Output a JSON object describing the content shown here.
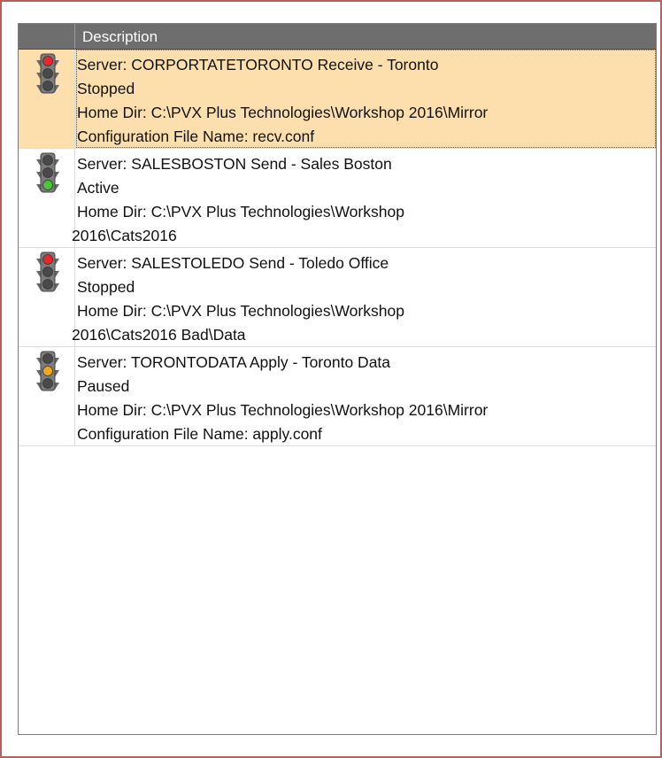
{
  "table": {
    "header": {
      "description": "Description"
    },
    "rows": [
      {
        "status_light": "red-traffic-light-icon",
        "server_line": "Server: CORPORTATETORONTO  Receive -  Toronto",
        "status": "Stopped",
        "detail1": "Home Dir: C:\\PVX Plus Technologies\\Workshop 2016\\Mirror",
        "detail2": "Configuration File Name: recv.conf",
        "selected": true
      },
      {
        "status_light": "green-traffic-light-icon",
        "server_line": "Server: SALESBOSTON  Send -  Sales Boston",
        "status": "Active",
        "detail1": "Home Dir: C:\\PVX Plus Technologies\\Workshop",
        "detail2": "2016\\Cats2016",
        "selected": false
      },
      {
        "status_light": "red-traffic-light-icon",
        "server_line": "Server: SALESTOLEDO  Send -  Toledo Office",
        "status": "Stopped",
        "detail1": "Home Dir: C:\\PVX Plus Technologies\\Workshop",
        "detail2": "2016\\Cats2016 Bad\\Data",
        "selected": false
      },
      {
        "status_light": "yellow-traffic-light-icon",
        "server_line": "Server: TORONTODATA  Apply -  Toronto Data",
        "status": "Paused",
        "detail1": "Home Dir: C:\\PVX Plus Technologies\\Workshop 2016\\Mirror",
        "detail2": "Configuration File Name: apply.conf",
        "selected": false
      }
    ]
  },
  "colors": {
    "selected_row": "#fcdfac",
    "header_bg": "#6e6e6e",
    "light_red": "#e8262b",
    "light_green": "#4cc43a",
    "light_yellow": "#f2a81d",
    "light_off": "#4a4a4a"
  }
}
